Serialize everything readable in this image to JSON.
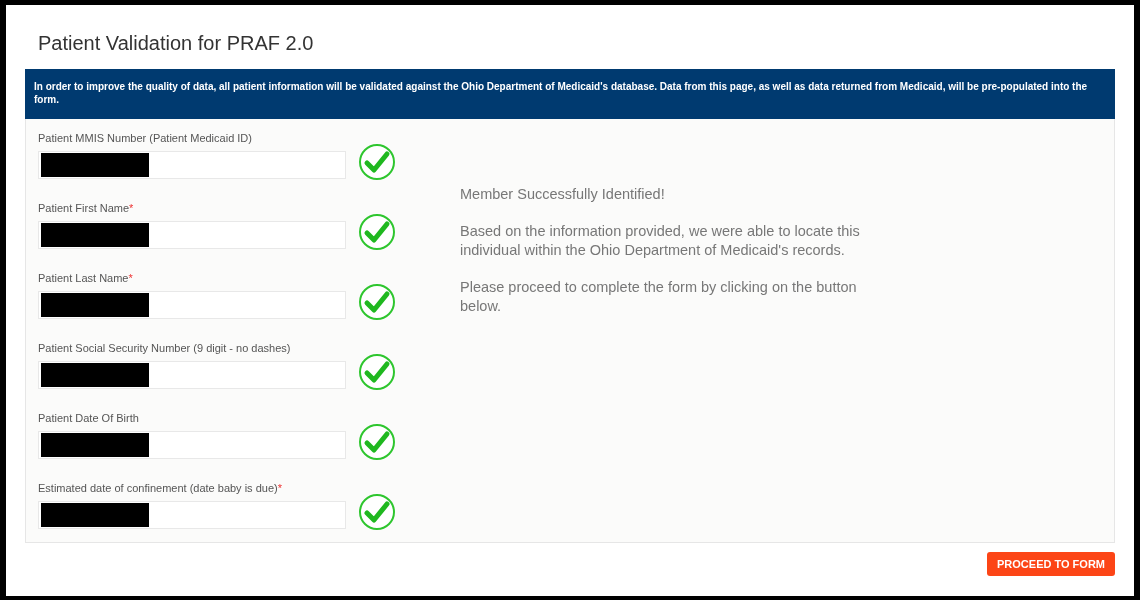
{
  "title": "Patient Validation for PRAF 2.0",
  "notice": "In order to improve the quality of data, all patient information will be validated against the Ohio Department of Medicaid's database. Data from this page, as well as data returned from Medicaid, will be pre-populated into the form.",
  "fields": [
    {
      "label": "Patient MMIS Number (Patient Medicaid ID)",
      "required": false,
      "redacted": true,
      "valid": true
    },
    {
      "label": "Patient First Name",
      "required": true,
      "redacted": true,
      "valid": true
    },
    {
      "label": "Patient Last Name",
      "required": true,
      "redacted": true,
      "valid": true
    },
    {
      "label": "Patient Social Security Number (9 digit - no dashes)",
      "required": false,
      "redacted": true,
      "valid": true
    },
    {
      "label": "Patient Date Of Birth",
      "required": false,
      "redacted": true,
      "valid": true
    },
    {
      "label": "Estimated date of confinement (date baby is due)",
      "required": true,
      "redacted": true,
      "valid": true
    }
  ],
  "required_mark": "*",
  "message": [
    "Member Successfully Identified!",
    "Based on the information provided, we were able to locate this individual within the Ohio Department of Medicaid's records.",
    "Please proceed to complete the form by clicking on the button below."
  ],
  "button": "PROCEED TO FORM"
}
